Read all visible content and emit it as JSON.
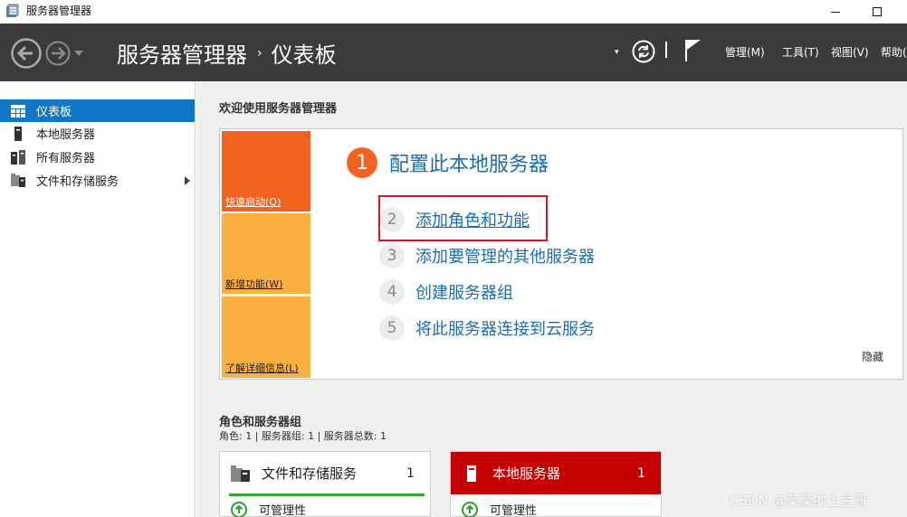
{
  "window": {
    "title": "服务器管理器",
    "icon": "server-manager-icon"
  },
  "header": {
    "breadcrumb_root": "服务器管理器",
    "breadcrumb_separator": "›",
    "breadcrumb_current": "仪表板",
    "dropdown_glyph": "▾",
    "menu": [
      "管理(M)",
      "工具(T)",
      "视图(V)",
      "帮助("
    ],
    "colors": {
      "background": "#3b3b3b"
    }
  },
  "sidebar": {
    "items": [
      {
        "label": "仪表板",
        "icon": "dashboard-icon",
        "active": true
      },
      {
        "label": "本地服务器",
        "icon": "server-icon",
        "active": false
      },
      {
        "label": "所有服务器",
        "icon": "servers-icon",
        "active": false
      },
      {
        "label": "文件和存储服务",
        "icon": "file-storage-icon",
        "active": false,
        "has_submenu": true
      }
    ],
    "colors": {
      "active": "#0e78c6"
    }
  },
  "welcome": {
    "title": "欢迎使用服务器管理器",
    "tiles": [
      "快速启动(Q)",
      "新增功能(W)",
      "了解详细信息(L)"
    ],
    "step1": {
      "number": "1",
      "label": "配置此本地服务器"
    },
    "steps": [
      {
        "number": "2",
        "label": "添加角色和功能"
      },
      {
        "number": "3",
        "label": "添加要管理的其他服务器"
      },
      {
        "number": "4",
        "label": "创建服务器组"
      },
      {
        "number": "5",
        "label": "将此服务器连接到云服务"
      }
    ],
    "hide_label": "隐藏",
    "colors": {
      "accent": "#f26322",
      "tile_secondary": "#fdb040",
      "link": "#1a6db0",
      "highlight": "#e0141c"
    }
  },
  "roles": {
    "title": "角色和服务器组",
    "summary": "角色: 1 | 服务器组: 1 | 服务器总数: 1",
    "cards": [
      {
        "name": "文件和存储服务",
        "count": "1",
        "status": "可管理性",
        "icon": "file-storage-icon"
      },
      {
        "name": "本地服务器",
        "count": "1",
        "status": "可管理性",
        "icon": "server-icon",
        "alert": true
      }
    ],
    "colors": {
      "ok": "#2bb02b",
      "alert": "#c40000"
    }
  },
  "watermark": "CSDN @菜菜的土豆哥"
}
